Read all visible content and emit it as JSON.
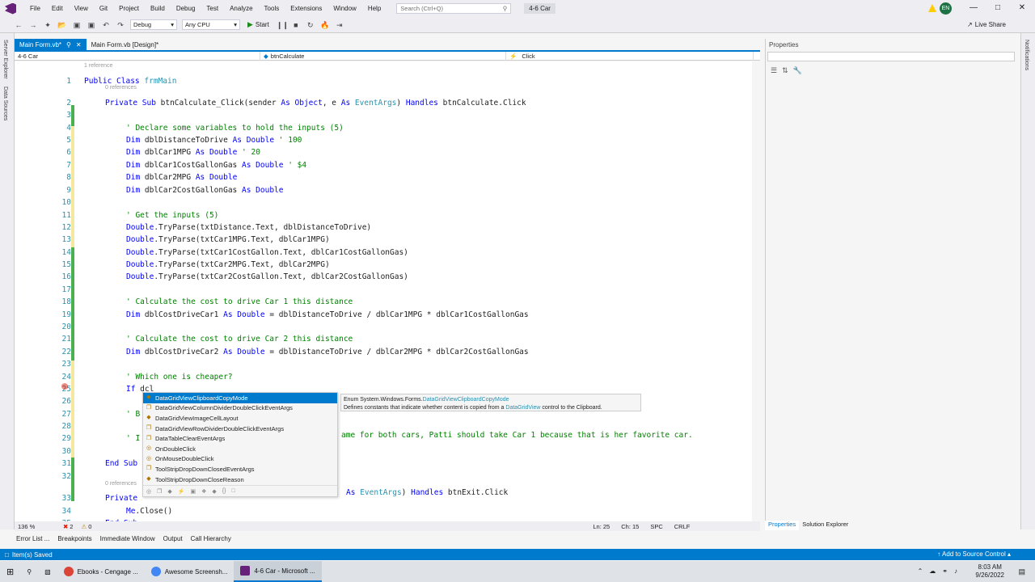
{
  "menubar": {
    "items": [
      "File",
      "Edit",
      "View",
      "Git",
      "Project",
      "Build",
      "Debug",
      "Test",
      "Analyze",
      "Tools",
      "Extensions",
      "Window",
      "Help"
    ],
    "search_placeholder": "Search (Ctrl+Q)",
    "solution_name": "4-6 Car",
    "avatar_initials": "EN"
  },
  "toolbar": {
    "config": "Debug",
    "platform": "Any CPU",
    "start_label": "Start",
    "live_share": "Live Share"
  },
  "left_strip": {
    "labels": [
      "Server Explorer",
      "Data Sources"
    ]
  },
  "right_strip": {
    "label": "Notifications"
  },
  "tabs": [
    {
      "label": "Main Form.vb*",
      "active": true
    },
    {
      "label": "Main Form.vb [Design]*",
      "active": false
    }
  ],
  "navbar": {
    "project": "4-6 Car",
    "object": "btnCalculate",
    "event": "Click"
  },
  "editor": {
    "references": {
      "class": "1 reference",
      "sub1": "0 references",
      "sub2": "0 references"
    },
    "lines": [
      {
        "n": "1",
        "html": "<span class='kw'>Public Class</span> <span class='ty'>frmMain</span>",
        "indent": 0
      },
      {
        "n": "2",
        "html": "<span class='kw'>Private Sub</span> btnCalculate_Click(sender <span class='kw'>As Object</span>, e <span class='kw'>As</span> <span class='ty'>EventArgs</span>) <span class='kw'>Handles</span> btnCalculate.Click",
        "indent": 1
      },
      {
        "n": "3",
        "html": "",
        "indent": 0
      },
      {
        "n": "4",
        "html": "<span class='cm'>' Declare some variables to hold the inputs (5)</span>",
        "indent": 2
      },
      {
        "n": "5",
        "html": "<span class='kw'>Dim</span> dblDistanceToDrive <span class='kw'>As Double</span> <span class='cm'>' 100</span>",
        "indent": 2
      },
      {
        "n": "6",
        "html": "<span class='kw'>Dim</span> dblCar1MPG <span class='kw'>As Double</span> <span class='cm'>' 20</span>",
        "indent": 2
      },
      {
        "n": "7",
        "html": "<span class='kw'>Dim</span> dblCar1CostGallonGas <span class='kw'>As Double</span> <span class='cm'>' $4</span>",
        "indent": 2
      },
      {
        "n": "8",
        "html": "<span class='kw'>Dim</span> dblCar2MPG <span class='kw'>As Double</span>",
        "indent": 2
      },
      {
        "n": "9",
        "html": "<span class='kw'>Dim</span> dblCar2CostGallonGas <span class='kw'>As Double</span>",
        "indent": 2
      },
      {
        "n": "10",
        "html": "",
        "indent": 0
      },
      {
        "n": "11",
        "html": "<span class='cm'>' Get the inputs (5)</span>",
        "indent": 2
      },
      {
        "n": "12",
        "html": "<span class='kw'>Double</span>.TryParse(txtDistance.Text, dblDistanceToDrive)",
        "indent": 2
      },
      {
        "n": "13",
        "html": "<span class='kw'>Double</span>.TryParse(txtCar1MPG.Text, dblCar1MPG)",
        "indent": 2
      },
      {
        "n": "14",
        "html": "<span class='kw'>Double</span>.TryParse(txtCar1CostGallon.Text, dblCar1CostGallonGas)",
        "indent": 2
      },
      {
        "n": "15",
        "html": "<span class='kw'>Double</span>.TryParse(txtCar2MPG.Text, dblCar2MPG)",
        "indent": 2
      },
      {
        "n": "16",
        "html": "<span class='kw'>Double</span>.TryParse(txtCar2CostGallon.Text, dblCar2CostGallonGas)",
        "indent": 2
      },
      {
        "n": "17",
        "html": "",
        "indent": 0
      },
      {
        "n": "18",
        "html": "<span class='cm'>' Calculate the cost to drive Car 1 this distance</span>",
        "indent": 2
      },
      {
        "n": "19",
        "html": "<span class='kw'>Dim</span> dblCostDriveCar1 <span class='kw'>As Double</span> = dblDistanceToDrive / dblCar1MPG * dblCar1CostGallonGas",
        "indent": 2
      },
      {
        "n": "20",
        "html": "",
        "indent": 0
      },
      {
        "n": "21",
        "html": "<span class='cm'>' Calculate the cost to drive Car 2 this distance</span>",
        "indent": 2
      },
      {
        "n": "22",
        "html": "<span class='kw'>Dim</span> dblCostDriveCar2 <span class='kw'>As Double</span> = dblDistanceToDrive / dblCar2MPG * dblCar2CostGallonGas",
        "indent": 2
      },
      {
        "n": "23",
        "html": "",
        "indent": 0
      },
      {
        "n": "24",
        "html": "<span class='cm'>' Which one is cheaper?</span>",
        "indent": 2
      },
      {
        "n": "25",
        "html": "<span class='kw'>If</span> dcl",
        "indent": 2
      },
      {
        "n": "26",
        "html": "",
        "indent": 0
      },
      {
        "n": "27",
        "html": "<span class='cm'>' B</span>",
        "indent": 2
      },
      {
        "n": "28",
        "html": "",
        "indent": 0
      },
      {
        "n": "29",
        "html": "<span class='cm'>' I</span>",
        "indent": 2
      },
      {
        "n": "30",
        "html": "",
        "indent": 0
      },
      {
        "n": "31",
        "html": "<span class='kw'>End Sub</span>",
        "indent": 1
      },
      {
        "n": "32",
        "html": "",
        "indent": 0
      },
      {
        "n": "33",
        "html": "<span class='kw'>Private</span>",
        "indent": 1
      },
      {
        "n": "34",
        "html": "<span class='kw'>Me</span>.Close()",
        "indent": 2
      },
      {
        "n": "35",
        "html": "<span class='kw'>End Sub</span>",
        "indent": 1
      }
    ],
    "line29_tail": "ame for both cars, Patti should take Car 1 because that is her favorite car.",
    "line33_tail": "As EventArgs) Handles btnExit.Click"
  },
  "autocomplete": {
    "items": [
      "DataGridViewClipboardCopyMode",
      "DataGridViewColumnDividerDoubleClickEventArgs",
      "DataGridViewImageCellLayout",
      "DataGridViewRowDividerDoubleClickEventArgs",
      "DataTableClearEventArgs",
      "OnDoubleClick",
      "OnMouseDoubleClick",
      "ToolStripDropDownClosedEventArgs",
      "ToolStripDropDownCloseReason"
    ],
    "tooltip_line1_prefix": "Enum System.Windows.Forms.",
    "tooltip_line1_link": "DataGridViewClipboardCopyMode",
    "tooltip_line2_a": "Defines constants that indicate whether content is copied from a ",
    "tooltip_line2_link": "DataGridView",
    "tooltip_line2_b": " control to the Clipboard."
  },
  "editor_status": {
    "zoom": "136 %",
    "errors": "2",
    "warnings": "0",
    "position": "Ln: 25",
    "column": "Ch: 15",
    "spc": "SPC",
    "crlf": "CRLF"
  },
  "properties": {
    "title": "Properties",
    "tabs": [
      "Properties",
      "Solution Explorer"
    ]
  },
  "bottom_tabs": [
    "Error List ...",
    "Breakpoints",
    "Immediate Window",
    "Output",
    "Call Hierarchy"
  ],
  "statusbar": {
    "message": "Item(s) Saved",
    "source_control": "Add to Source Control"
  },
  "taskbar": {
    "items": [
      "Ebooks - Cengage ...",
      "Awesome Screensh...",
      "4-6 Car - Microsoft ..."
    ],
    "time": "8:03 AM",
    "date": "9/26/2022"
  },
  "colors": {
    "accent": "#007acc",
    "keyword": "#0000ff",
    "comment": "#008000",
    "type": "#2b91af"
  }
}
